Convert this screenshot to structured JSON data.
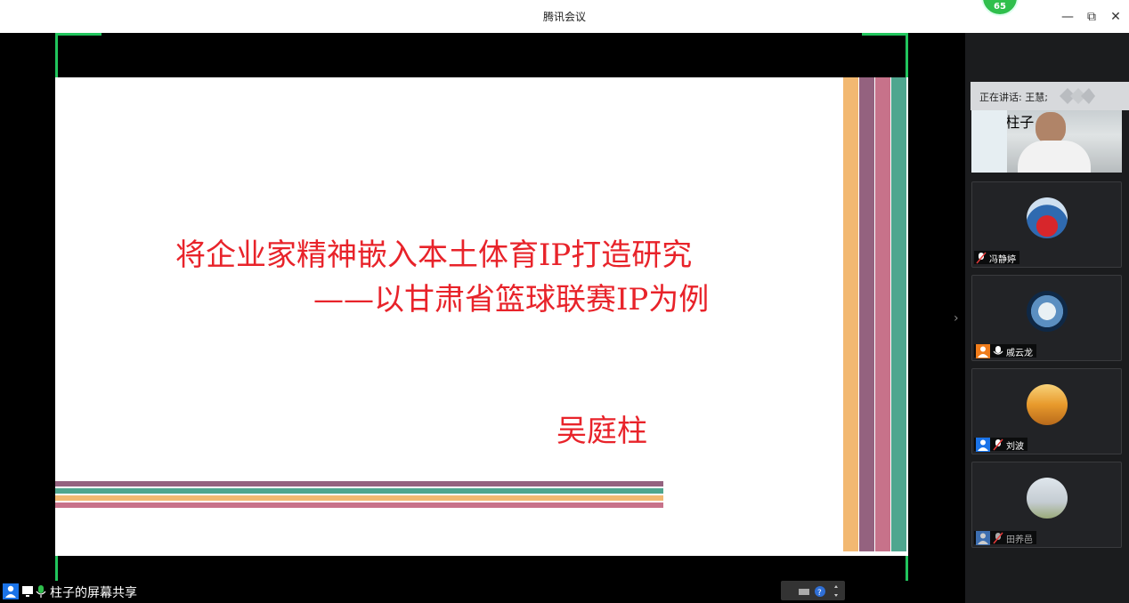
{
  "window": {
    "title": "腾讯会议",
    "badge": "65",
    "buttons": {
      "minimize": "—",
      "restore": "⧉",
      "close": "✕"
    }
  },
  "slide": {
    "title_line1": "将企业家精神嵌入本土体育IP打造研究",
    "title_line2": "——以甘肃省篮球联赛IP为例",
    "author": "吴庭柱",
    "colors": {
      "title": "#e8232a",
      "stripe_orange": "#f2b871",
      "stripe_purple": "#94627f",
      "stripe_pink": "#c7728a",
      "stripe_teal": "#4fa68f"
    }
  },
  "share_bar": {
    "label": "柱子的屏幕共享"
  },
  "sidebar": {
    "speaking_label": "正在讲话: 王慧;",
    "participants": [
      {
        "name": "柱子",
        "type": "video",
        "mic": "on",
        "role_color": "#1a73e8"
      },
      {
        "name": "冯静婷",
        "type": "avatar",
        "mic": "muted",
        "avatar": "red-person"
      },
      {
        "name": "戚云龙",
        "type": "avatar",
        "mic": "on",
        "avatar": "earth",
        "role_color": "#f07c1b"
      },
      {
        "name": "刘波",
        "type": "avatar",
        "mic": "muted",
        "avatar": "desert",
        "role_color": "#1a73e8"
      },
      {
        "name": "田养邑",
        "type": "avatar",
        "mic": "muted",
        "avatar": "sky",
        "role_color": "#1a73e8"
      }
    ]
  }
}
